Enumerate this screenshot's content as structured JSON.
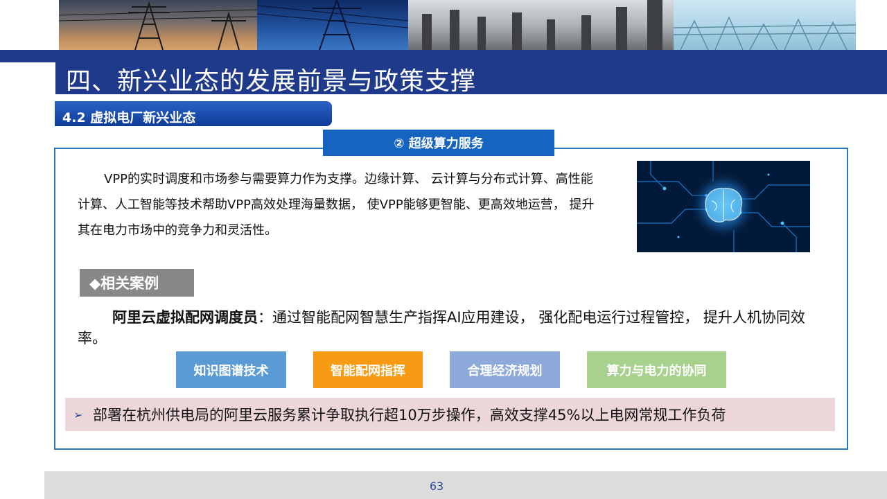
{
  "header": {
    "title": "四、新兴业态的发展前景与政策支撑",
    "section": "4.2 虚拟电厂新兴业态",
    "subsection": "② 超级算力服务"
  },
  "intro": {
    "text": "VPP的实时调度和市场参与需要算力作为支撑。边缘计算、 云计算与分布式计算、高性能计算、人工智能等技术帮助VPP高效处理海量数据， 使VPP能够更智能、更高效地运营， 提升其在电力市场中的竞争力和灵活性。"
  },
  "cases": {
    "tag": "◆相关案例",
    "case_title": "阿里云虚拟配网调度员",
    "case_body": "：通过智能配网智慧生产指挥AI应用建设， 强化配电运行过程管控， 提升人机协同效率。"
  },
  "chips": [
    {
      "label": "知识图谱技术",
      "color": "#5b9bd5"
    },
    {
      "label": "智能配网指挥",
      "color": "#f79a14"
    },
    {
      "label": "合理经济规划",
      "color": "#8eaadb"
    },
    {
      "label": "算力与电力的协同",
      "color": "#a9d18e"
    }
  ],
  "note": {
    "arrow": "➢",
    "text": "部署在杭州供电局的阿里云服务累计争取执行超10万步操作，高效支撑45%以上电网常规工作负荷"
  },
  "footer": {
    "page_number": "63"
  },
  "colors": {
    "primary": "#1f3a8a",
    "frame": "#2677bd"
  }
}
